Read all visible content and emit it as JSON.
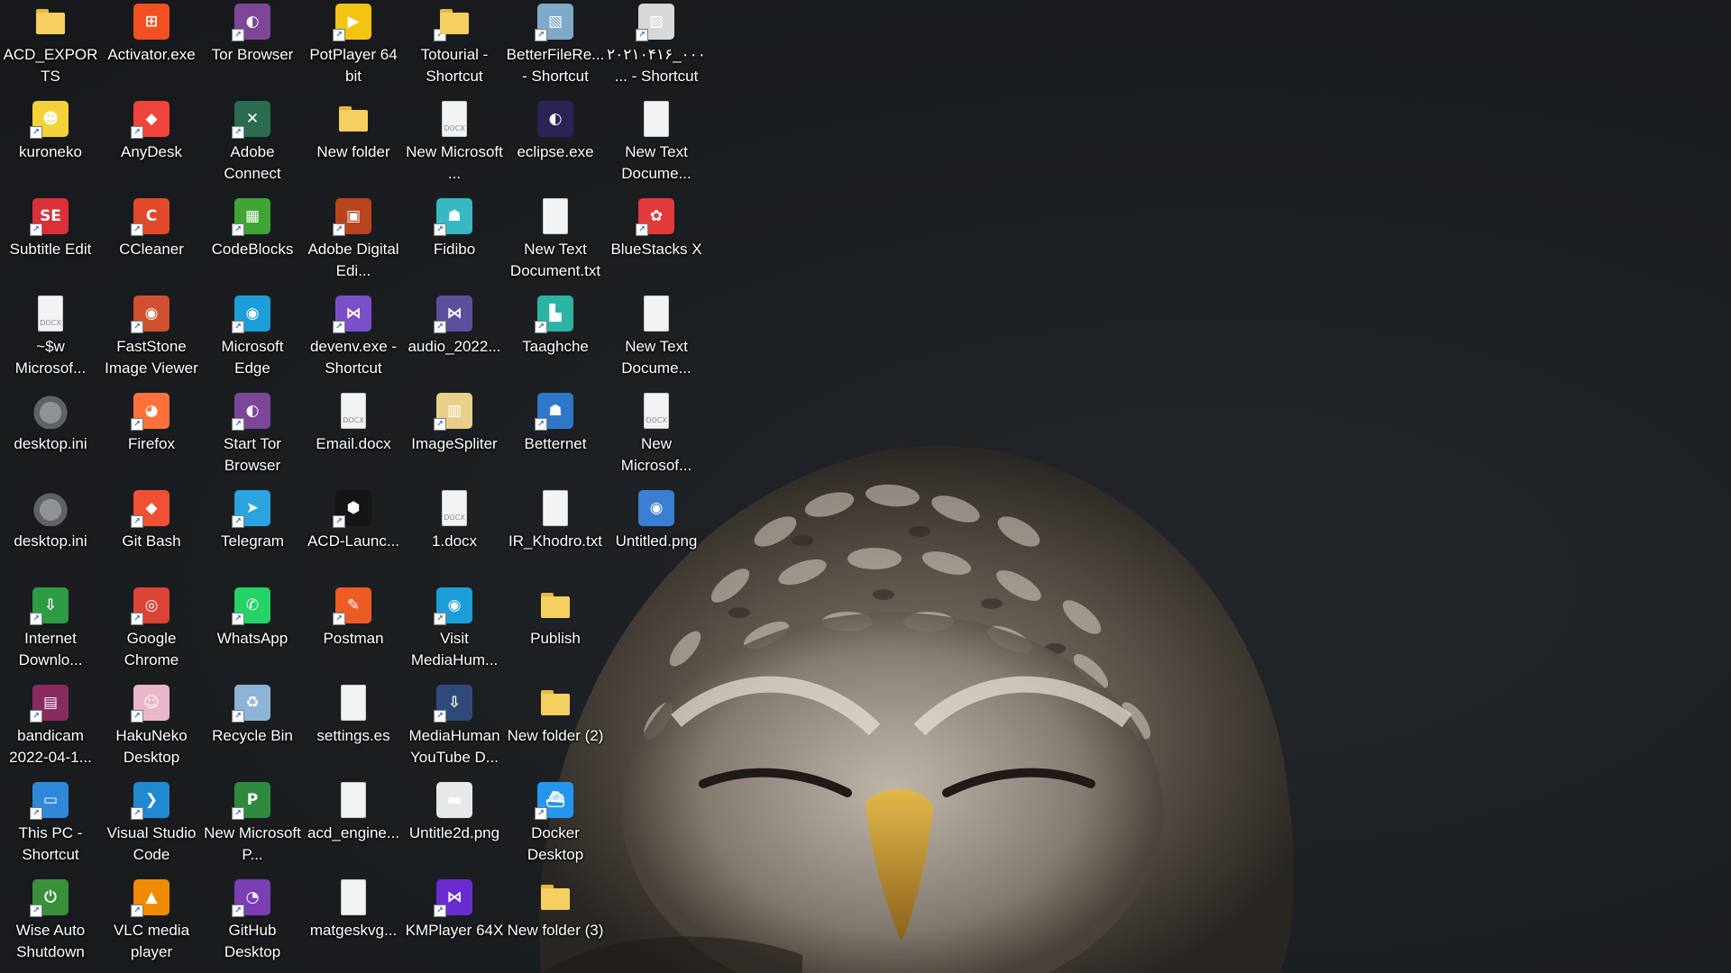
{
  "desktop": {
    "wallpaper_colors": {
      "background": "#1b1e21",
      "feather_light": "#d8d2c6",
      "feather_dark": "#3a3530",
      "beak": "#c99a2e"
    },
    "icons": [
      {
        "label": "ACD_EXPORTS",
        "icon": "folder-icon",
        "color": "#f5cf60",
        "type": "folder"
      },
      {
        "label": "kuroneko",
        "icon": "kuroneko-icon",
        "color": "#f4d23a",
        "glyph": "☻"
      },
      {
        "label": "Subtitle Edit",
        "icon": "subtitle-edit-icon",
        "color": "#d9303a",
        "glyph": "SE"
      },
      {
        "label": "~$w Microsof...",
        "icon": "word-temp-doc-icon",
        "color": "#9a9a9a",
        "type": "doc",
        "glyph": "DOCX"
      },
      {
        "label": "desktop.ini",
        "icon": "settings-file-icon",
        "color": "#6e7176",
        "type": "gear"
      },
      {
        "label": "desktop.ini",
        "icon": "settings-file-icon",
        "color": "#6e7176",
        "type": "gear"
      },
      {
        "label": "Internet Downlo...",
        "icon": "internet-download-manager-icon",
        "color": "#2e9b45",
        "glyph": "⇩"
      },
      {
        "label": "bandicam 2022-04-1...",
        "icon": "winrar-archive-icon",
        "color": "#8a2b5e",
        "glyph": "▤"
      },
      {
        "label": "This PC - Shortcut",
        "icon": "computer-icon",
        "color": "#2f88d8",
        "glyph": "▭"
      },
      {
        "label": "Wise Auto Shutdown",
        "icon": "wise-auto-shutdown-icon",
        "color": "#3a8f3a",
        "glyph": "⏻"
      },
      {
        "label": "Activator.exe",
        "icon": "windows-logo-icon",
        "color": "#f25022",
        "glyph": "⊞"
      },
      {
        "label": "AnyDesk",
        "icon": "anydesk-icon",
        "color": "#ef443b",
        "glyph": "◆"
      },
      {
        "label": "CCleaner",
        "icon": "ccleaner-icon",
        "color": "#e04a2a",
        "glyph": "C"
      },
      {
        "label": "FastStone Image Viewer",
        "icon": "eye-icon",
        "color": "#d05030",
        "glyph": "◉"
      },
      {
        "label": "Firefox",
        "icon": "firefox-icon",
        "color": "#ff7139",
        "glyph": "◕"
      },
      {
        "label": "Git Bash",
        "icon": "git-icon",
        "color": "#f05133",
        "glyph": "◆"
      },
      {
        "label": "Google Chrome",
        "icon": "chrome-icon",
        "color": "#db4437",
        "glyph": "◎"
      },
      {
        "label": "HakuNeko Desktop",
        "icon": "hakuneko-icon",
        "color": "#e9b7c8",
        "glyph": "☺"
      },
      {
        "label": "Visual Studio Code",
        "icon": "vscode-icon",
        "color": "#1f8ad2",
        "glyph": "❯"
      },
      {
        "label": "VLC media player",
        "icon": "vlc-cone-icon",
        "color": "#f08a00",
        "glyph": "▲"
      },
      {
        "label": "Tor Browser",
        "icon": "tor-icon",
        "color": "#7d4698",
        "glyph": "◐"
      },
      {
        "label": "Adobe Connect",
        "icon": "adobe-connect-icon",
        "color": "#2b6b4f",
        "glyph": "✕"
      },
      {
        "label": "CodeBlocks",
        "icon": "codeblocks-icon",
        "color": "#3fa535",
        "glyph": "▦"
      },
      {
        "label": "Microsoft Edge",
        "icon": "edge-icon",
        "color": "#1c9fd8",
        "glyph": "◉"
      },
      {
        "label": "Start Tor Browser",
        "icon": "tor-icon",
        "color": "#7d4698",
        "glyph": "◐"
      },
      {
        "label": "Telegram",
        "icon": "telegram-icon",
        "color": "#2aa3df",
        "glyph": "➤"
      },
      {
        "label": "WhatsApp",
        "icon": "whatsapp-icon",
        "color": "#25d366",
        "glyph": "✆"
      },
      {
        "label": "Recycle Bin",
        "icon": "recycle-bin-icon",
        "color": "#8cb4d6",
        "glyph": "♻"
      },
      {
        "label": "New Microsoft P...",
        "icon": "project-icon",
        "color": "#2f8a3f",
        "glyph": "P"
      },
      {
        "label": "GitHub Desktop",
        "icon": "github-icon",
        "color": "#7b3fb5",
        "glyph": "◔"
      },
      {
        "label": "PotPlayer 64 bit",
        "icon": "potplayer-icon",
        "color": "#f3c414",
        "glyph": "▶"
      },
      {
        "label": "New folder",
        "icon": "folder-icon",
        "color": "#f5cf60",
        "type": "folder"
      },
      {
        "label": "Adobe Digital Edi...",
        "icon": "adobe-digital-editions-icon",
        "color": "#b8451d",
        "glyph": "▣"
      },
      {
        "label": "devenv.exe - Shortcut",
        "icon": "visual-studio-icon",
        "color": "#7b4fc9",
        "glyph": "⋈"
      },
      {
        "label": "Email.docx",
        "icon": "docx-file-icon",
        "color": "#9a9a9a",
        "type": "doc",
        "glyph": "DOCX"
      },
      {
        "label": "ACD-Launc...",
        "icon": "acd-launcher-icon",
        "color": "#151515",
        "glyph": "⬢"
      },
      {
        "label": "Postman",
        "icon": "postman-icon",
        "color": "#ef5b25",
        "glyph": "✎"
      },
      {
        "label": "settings.es",
        "icon": "blank-file-icon",
        "color": "#f3f3f3",
        "type": "doc",
        "glyph": ""
      },
      {
        "label": "acd_engine...",
        "icon": "blank-file-icon",
        "color": "#f3f3f3",
        "type": "doc",
        "glyph": ""
      },
      {
        "label": "matgeskvg...",
        "icon": "blank-file-icon",
        "color": "#f3f3f3",
        "type": "doc",
        "glyph": ""
      },
      {
        "label": "Totourial - Shortcut",
        "icon": "folder-shortcut-icon",
        "color": "#f5cf60",
        "type": "folder"
      },
      {
        "label": "New Microsoft ...",
        "icon": "docx-file-icon",
        "color": "#9a9a9a",
        "type": "doc",
        "glyph": "DOCX"
      },
      {
        "label": "Fidibo",
        "icon": "fidibo-icon",
        "color": "#37b8c2",
        "glyph": "☗"
      },
      {
        "label": "audio_2022...",
        "icon": "ogg-audio-icon",
        "color": "#5a4f9a",
        "glyph": "⋈"
      },
      {
        "label": "ImageSpliter",
        "icon": "image-spliter-icon",
        "color": "#e8d08a",
        "glyph": "▥"
      },
      {
        "label": "1.docx",
        "icon": "docx-file-icon",
        "color": "#9a9a9a",
        "type": "doc",
        "glyph": "DOCX"
      },
      {
        "label": "Visit MediaHum...",
        "icon": "edge-icon",
        "color": "#1c9fd8",
        "glyph": "◉"
      },
      {
        "label": "MediaHuman YouTube D...",
        "icon": "mediahuman-icon",
        "color": "#2f4a7a",
        "glyph": "⇩"
      },
      {
        "label": "Untitle2d.png",
        "icon": "png-thumbnail-icon",
        "color": "#e8e8e8",
        "glyph": "▬"
      },
      {
        "label": "KMPlayer 64X",
        "icon": "kmplayer-icon",
        "color": "#6a2bd1",
        "glyph": "⋈"
      },
      {
        "label": "BetterFileRe... - Shortcut",
        "icon": "betterfilerename-icon",
        "color": "#7fa9c9",
        "glyph": "▧"
      },
      {
        "label": "eclipse.exe",
        "icon": "eclipse-icon",
        "color": "#2c2255",
        "glyph": "◐"
      },
      {
        "label": "New Text Document.txt",
        "icon": "text-file-icon",
        "color": "#f3f3f3",
        "type": "doc",
        "glyph": ""
      },
      {
        "label": "Taaghche",
        "icon": "taaghche-icon",
        "color": "#2bb3a3",
        "glyph": "▙"
      },
      {
        "label": "Betternet",
        "icon": "betternet-icon",
        "color": "#2f78c9",
        "glyph": "☗"
      },
      {
        "label": "IR_Khodro.txt",
        "icon": "text-file-icon",
        "color": "#f3f3f3",
        "type": "doc",
        "glyph": ""
      },
      {
        "label": "Publish",
        "icon": "folder-icon",
        "color": "#f5cf60",
        "type": "folder"
      },
      {
        "label": "New folder (2)",
        "icon": "folder-icon",
        "color": "#f5cf60",
        "type": "folder"
      },
      {
        "label": "Docker Desktop",
        "icon": "docker-icon",
        "color": "#2496ed",
        "glyph": "⛴"
      },
      {
        "label": "New folder (3)",
        "icon": "folder-icon",
        "color": "#f5cf60",
        "type": "folder"
      },
      {
        "label": "۲۰۲۱۰۴۱۶_۰۰۰... - Shortcut",
        "icon": "image-file-shortcut-icon",
        "color": "#d8d8d8",
        "glyph": "▨"
      },
      {
        "label": "New Text Docume...",
        "icon": "text-file-icon",
        "color": "#f3f3f3",
        "type": "doc",
        "glyph": ""
      },
      {
        "label": "BlueStacks X",
        "icon": "bluestacks-icon",
        "color": "#e23a3a",
        "glyph": "✿"
      },
      {
        "label": "New Text Docume...",
        "icon": "text-file-icon",
        "color": "#f3f3f3",
        "type": "doc",
        "glyph": ""
      },
      {
        "label": "New Microsof...",
        "icon": "docx-file-icon",
        "color": "#9a9a9a",
        "type": "doc",
        "glyph": "DOCX"
      },
      {
        "label": "Untitled.png",
        "icon": "png-thumbnail-icon",
        "color": "#3a7fd1",
        "glyph": "◉"
      }
    ]
  }
}
